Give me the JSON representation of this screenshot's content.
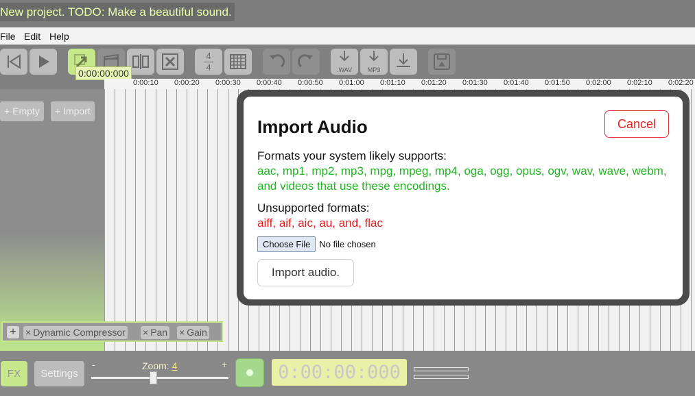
{
  "app": {
    "title": "New project. TODO: Make a beautiful sound."
  },
  "menu": {
    "items": [
      "File",
      "Edit",
      "Help"
    ]
  },
  "toolbar": {
    "time_signature": {
      "top": "4",
      "bottom": "4"
    },
    "export_wav_label": ".WAV",
    "export_mp3_label": "MP3",
    "cursor_time": "0:00:00:000"
  },
  "ruler": {
    "ticks": [
      "0:00:10",
      "0:00:20",
      "0:00:30",
      "0:00:40",
      "0:00:50",
      "0:01:00",
      "0:01:10",
      "0:01:20",
      "0:01:30",
      "0:01:40",
      "0:01:50",
      "0:02:00",
      "0:02:10",
      "0:02:20"
    ]
  },
  "tracks_panel": {
    "add_empty": "+ Empty",
    "add_import": "+ Import"
  },
  "effects": {
    "add": "+",
    "chain": [
      "Dynamic Compressor",
      "Pan",
      "Gain"
    ],
    "remove_symbol": "×"
  },
  "bottom": {
    "fx_label": "FX",
    "settings_label": "Settings",
    "zoom": {
      "label": "Zoom:",
      "value": "4",
      "minus": "-",
      "plus": "+",
      "level": 0.45
    },
    "time_display": "0:00:00:000"
  },
  "dialog": {
    "title": "Import Audio",
    "cancel_label": "Cancel",
    "supported_label": "Formats your system likely supports:",
    "supported_formats": "aac, mp1, mp2, mp3, mpg, mpeg, mp4, oga, ogg, opus, ogv, wav, wave, webm, and videos that use these encodings.",
    "unsupported_label": "Unsupported formats:",
    "unsupported_formats": "aiff, aif, aic, au, and, flac",
    "choose_file_label": "Choose File",
    "no_file_label": "No file chosen",
    "import_label": "Import audio."
  },
  "colors": {
    "accent": "#c7e88a",
    "supported": "#22b422",
    "unsupported": "#e61a1a",
    "cancel": "#e62222"
  }
}
